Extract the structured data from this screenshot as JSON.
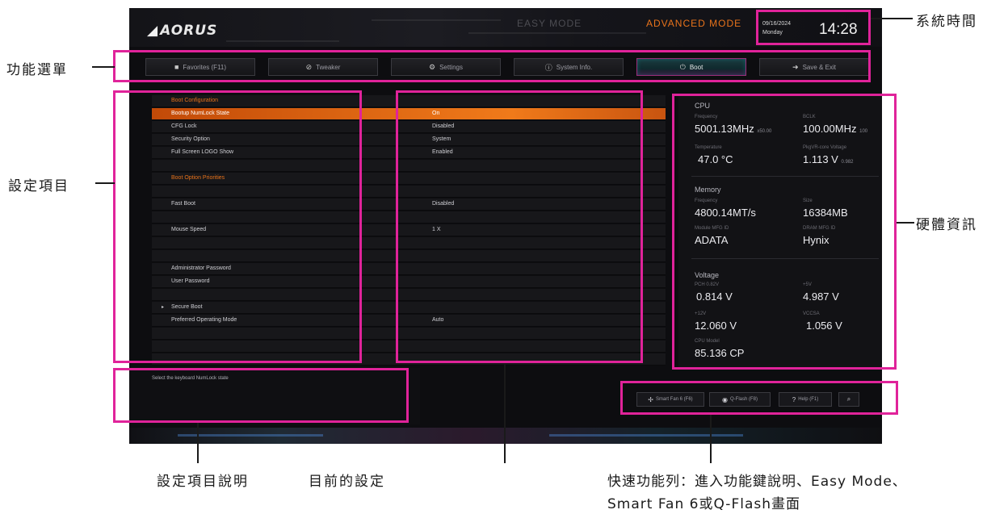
{
  "bios": {
    "brand": "AORUS",
    "mode_easy": "EASY MODE",
    "mode_advanced": "ADVANCED MODE",
    "date": "09/16/2024",
    "day": "Monday",
    "time": "14:28",
    "tabs": [
      {
        "label": "Favorites (F11)",
        "icon": "star-icon"
      },
      {
        "label": "Tweaker",
        "icon": "tweaker-icon"
      },
      {
        "label": "Settings",
        "icon": "gear-icon"
      },
      {
        "label": "System Info.",
        "icon": "info-icon"
      },
      {
        "label": "Boot",
        "icon": "power-icon",
        "active": true
      },
      {
        "label": "Save & Exit",
        "icon": "exit-icon"
      }
    ],
    "rows": [
      {
        "label": "Boot Configuration",
        "value": "",
        "section": true
      },
      {
        "label": "Bootup NumLock State",
        "value": "On",
        "highlight": true
      },
      {
        "label": "CFG Lock",
        "value": "Disabled"
      },
      {
        "label": "Security Option",
        "value": "System"
      },
      {
        "label": "Full Screen LOGO Show",
        "value": "Enabled"
      },
      {
        "label": "",
        "value": ""
      },
      {
        "label": "Boot Option Priorities",
        "value": "",
        "section": true
      },
      {
        "label": "",
        "value": ""
      },
      {
        "label": "Fast Boot",
        "value": "Disabled"
      },
      {
        "label": "",
        "value": ""
      },
      {
        "label": "Mouse Speed",
        "value": "1 X"
      },
      {
        "label": "",
        "value": ""
      },
      {
        "label": "",
        "value": ""
      },
      {
        "label": "Administrator Password",
        "value": ""
      },
      {
        "label": "User Password",
        "value": ""
      },
      {
        "label": "",
        "value": ""
      },
      {
        "label": "Secure Boot",
        "value": "",
        "submenu": true
      },
      {
        "label": "Preferred Operating Mode",
        "value": "Auto"
      },
      {
        "label": "",
        "value": ""
      },
      {
        "label": "",
        "value": ""
      },
      {
        "label": "",
        "value": ""
      }
    ],
    "hw": {
      "cpu_title": "CPU",
      "freq_label": "Frequency",
      "freq_value": "5001.13MHz",
      "freq_extra": "x50.00",
      "bclk_label": "BCLK",
      "bclk_value": "100.00MHz",
      "bclk_extra": "100",
      "temp_label": "Temperature",
      "temp_value": "47.0 °C",
      "vcore_label": "PkgVR-core Voltage",
      "vcore_value": "1.113 V",
      "vcore_extra": "0.982",
      "mem_title": "Memory",
      "mem_freq_label": "Frequency",
      "mem_freq_value": "4800.14MT/s",
      "size_label": "Size",
      "size_value": "16384MB",
      "module_label": "Module MFG ID",
      "module_value": "ADATA",
      "dram_label": "DRAM MFG ID",
      "dram_value": "Hynix",
      "volt_title": "Voltage",
      "pch_label": "PCH 0.82V",
      "pch_value": "0.814 V",
      "v5_label": "+5V",
      "v5_value": "4.987 V",
      "v12_label": "+12V",
      "v12_value": "12.060 V",
      "vcc_label": "VCCSA",
      "vcc_value": "1.056 V",
      "cpu_model_label": "CPU Model",
      "cpu_model_value": "85.136 CP"
    },
    "description": "Select the keyboard NumLock state",
    "quick": [
      {
        "label": "Smart Fan 6 (F6)",
        "icon": "fan-icon"
      },
      {
        "label": "Q-Flash (F8)",
        "icon": "flash-icon"
      },
      {
        "label": "Help (F1)",
        "icon": "help-icon"
      },
      {
        "label": "",
        "icon": "search-icon"
      }
    ]
  },
  "annotations": {
    "system_time": "系統時間",
    "function_menu": "功能選單",
    "setting_items": "設定項目",
    "hardware_info": "硬體資訊",
    "item_description": "設定項目說明",
    "current_setting": "目前的設定",
    "quick_bar_line1": "快速功能列：進入功能鍵說明、Easy Mode、",
    "quick_bar_line2": "Smart Fan 6或Q-Flash畫面"
  }
}
